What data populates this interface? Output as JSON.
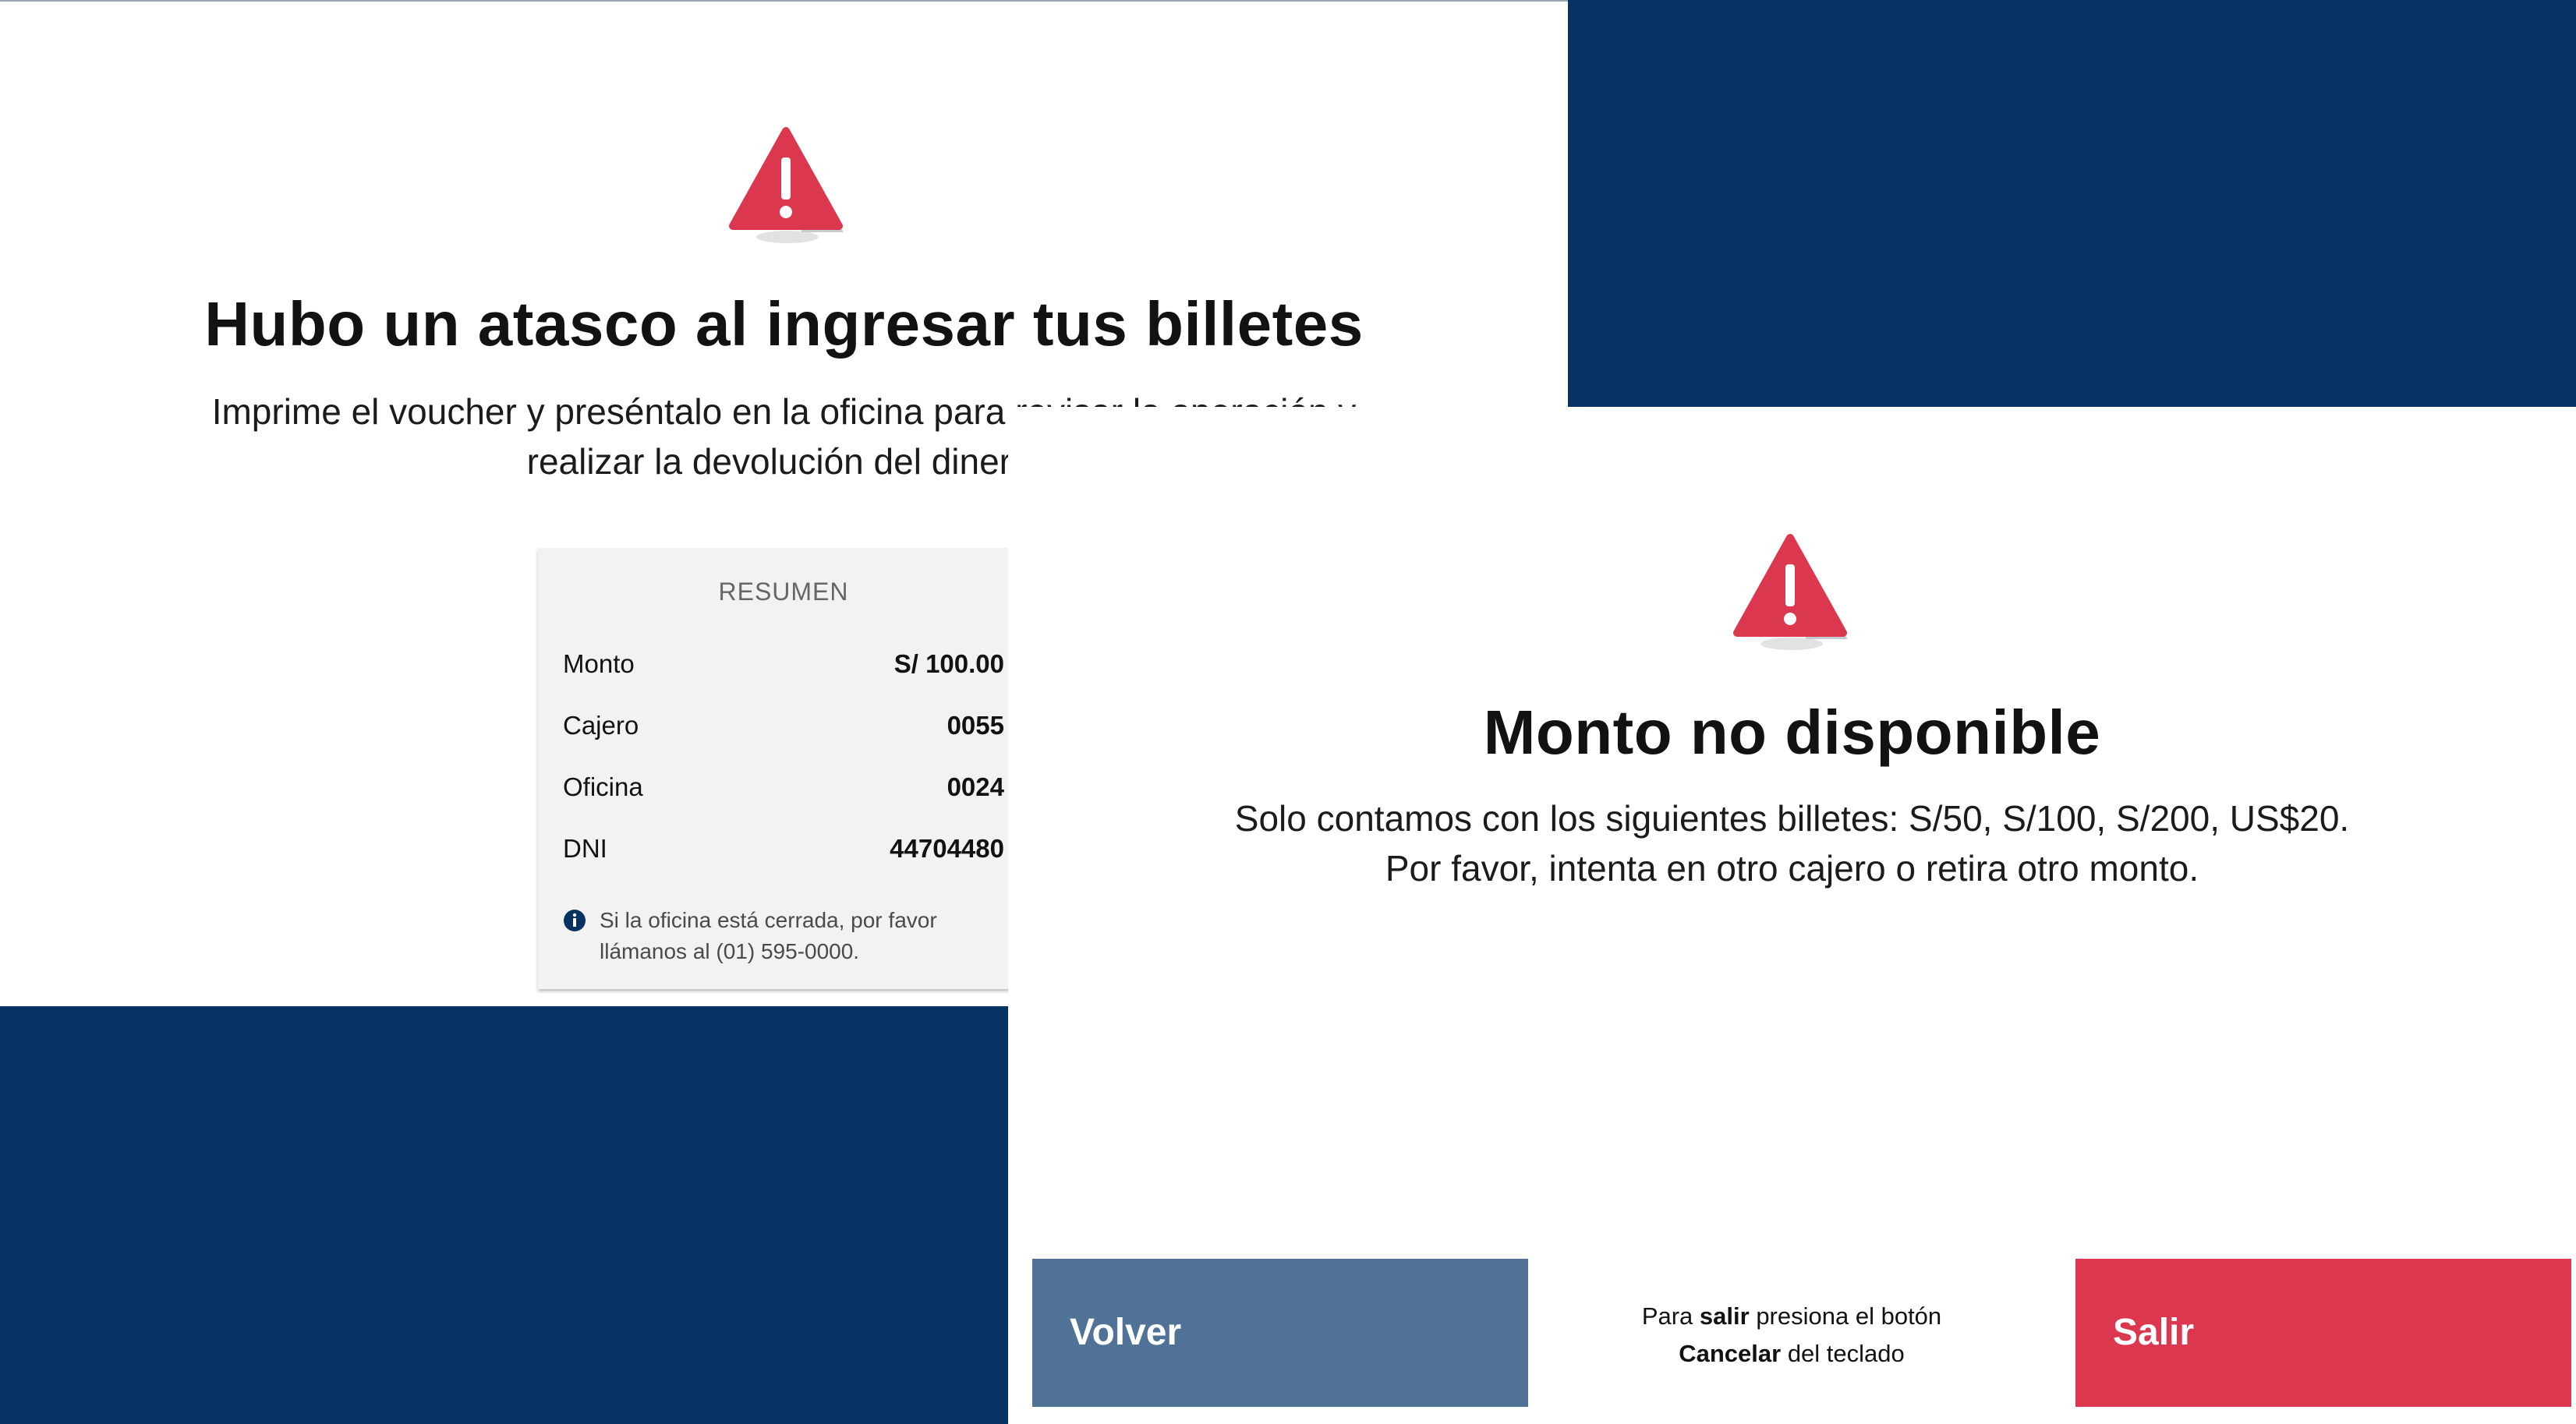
{
  "colors": {
    "navy": "#043263",
    "alert_red": "#db384f",
    "volver_blue": "#4f7296",
    "card_gray": "#f2f2f2"
  },
  "back_screen": {
    "icon": "warning-triangle-icon",
    "title": "Hubo un atasco al ingresar tus billetes",
    "subtitle_line1": "Imprime el voucher y preséntalo en la oficina para revisar la operación y",
    "subtitle_line2": "realizar la devolución del dinero.",
    "summary": {
      "title": "RESUMEN",
      "rows": [
        {
          "label": "Monto",
          "value": "S/ 100.00"
        },
        {
          "label": "Cajero",
          "value": "0055"
        },
        {
          "label": "Oficina",
          "value": "0024"
        },
        {
          "label": "DNI",
          "value": "44704480"
        }
      ],
      "note_icon": "info-icon",
      "note": "Si la oficina está cerrada, por favor llámanos al (01) 595-0000."
    }
  },
  "front_screen": {
    "icon": "warning-triangle-icon",
    "title": "Monto no disponible",
    "message_line1": "Solo contamos con los siguientes billetes: S/50, S/100, S/200, US$20.",
    "message_line2": "Por favor, intenta en otro cajero o retira otro monto.",
    "back_button": "Volver",
    "exit_button": "Salir",
    "hint": {
      "part1": "Para ",
      "bold1": "salir",
      "part2": " presiona el botón",
      "bold2": "Cancelar",
      "part3": " del teclado"
    }
  }
}
